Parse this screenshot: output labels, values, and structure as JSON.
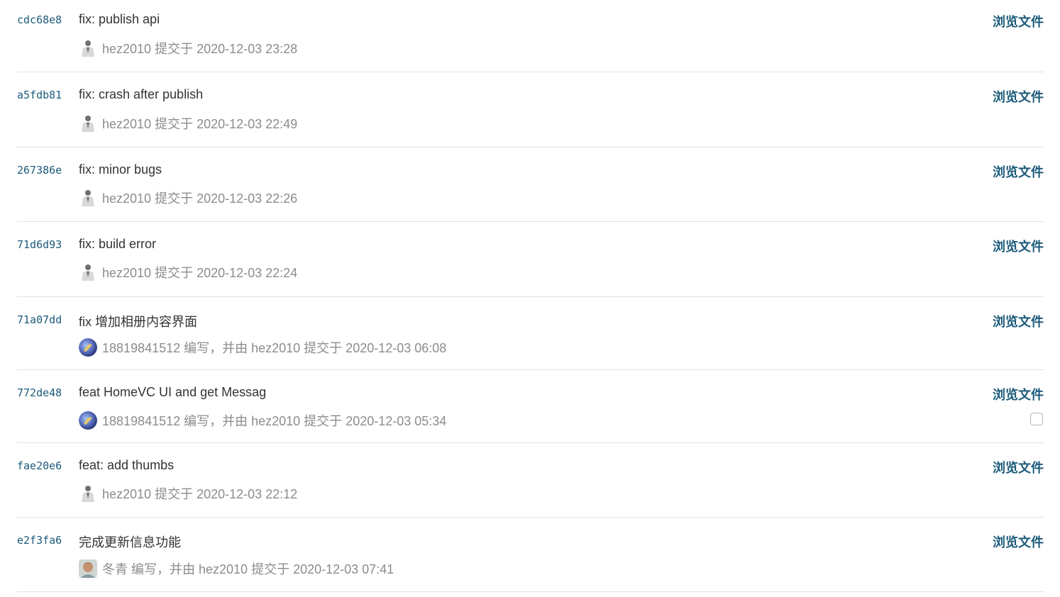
{
  "browse_label": "浏览文件",
  "commits": [
    {
      "sha": "cdc68e8",
      "title": "fix: publish api",
      "meta": "hez2010 提交于 2020-12-03 23:28",
      "avatar": "person-avatar"
    },
    {
      "sha": "a5fdb81",
      "title": "fix: crash after publish",
      "meta": "hez2010 提交于 2020-12-03 22:49",
      "avatar": "person-avatar"
    },
    {
      "sha": "267386e",
      "title": "fix: minor bugs",
      "meta": "hez2010 提交于 2020-12-03 22:26",
      "avatar": "person-avatar"
    },
    {
      "sha": "71d6d93",
      "title": "fix: build error",
      "meta": "hez2010 提交于 2020-12-03 22:24",
      "avatar": "person-avatar"
    },
    {
      "sha": "71a07dd",
      "title": "fix 增加相册内容界面",
      "meta": "18819841512 编写，并由 hez2010 提交于 2020-12-03 06:08",
      "avatar": "planet-avatar"
    },
    {
      "sha": "772de48",
      "title": "feat HomeVC UI and get Messag",
      "meta": "18819841512 编写，并由 hez2010 提交于 2020-12-03 05:34",
      "avatar": "planet-avatar"
    },
    {
      "sha": "fae20e6",
      "title": "feat: add thumbs",
      "meta": "hez2010 提交于 2020-12-03 22:12",
      "avatar": "person-avatar"
    },
    {
      "sha": "e2f3fa6",
      "title": "完成更新信息功能",
      "meta": "冬青 编写，并由 hez2010 提交于 2020-12-03 07:41",
      "avatar": "photo-avatar"
    }
  ]
}
